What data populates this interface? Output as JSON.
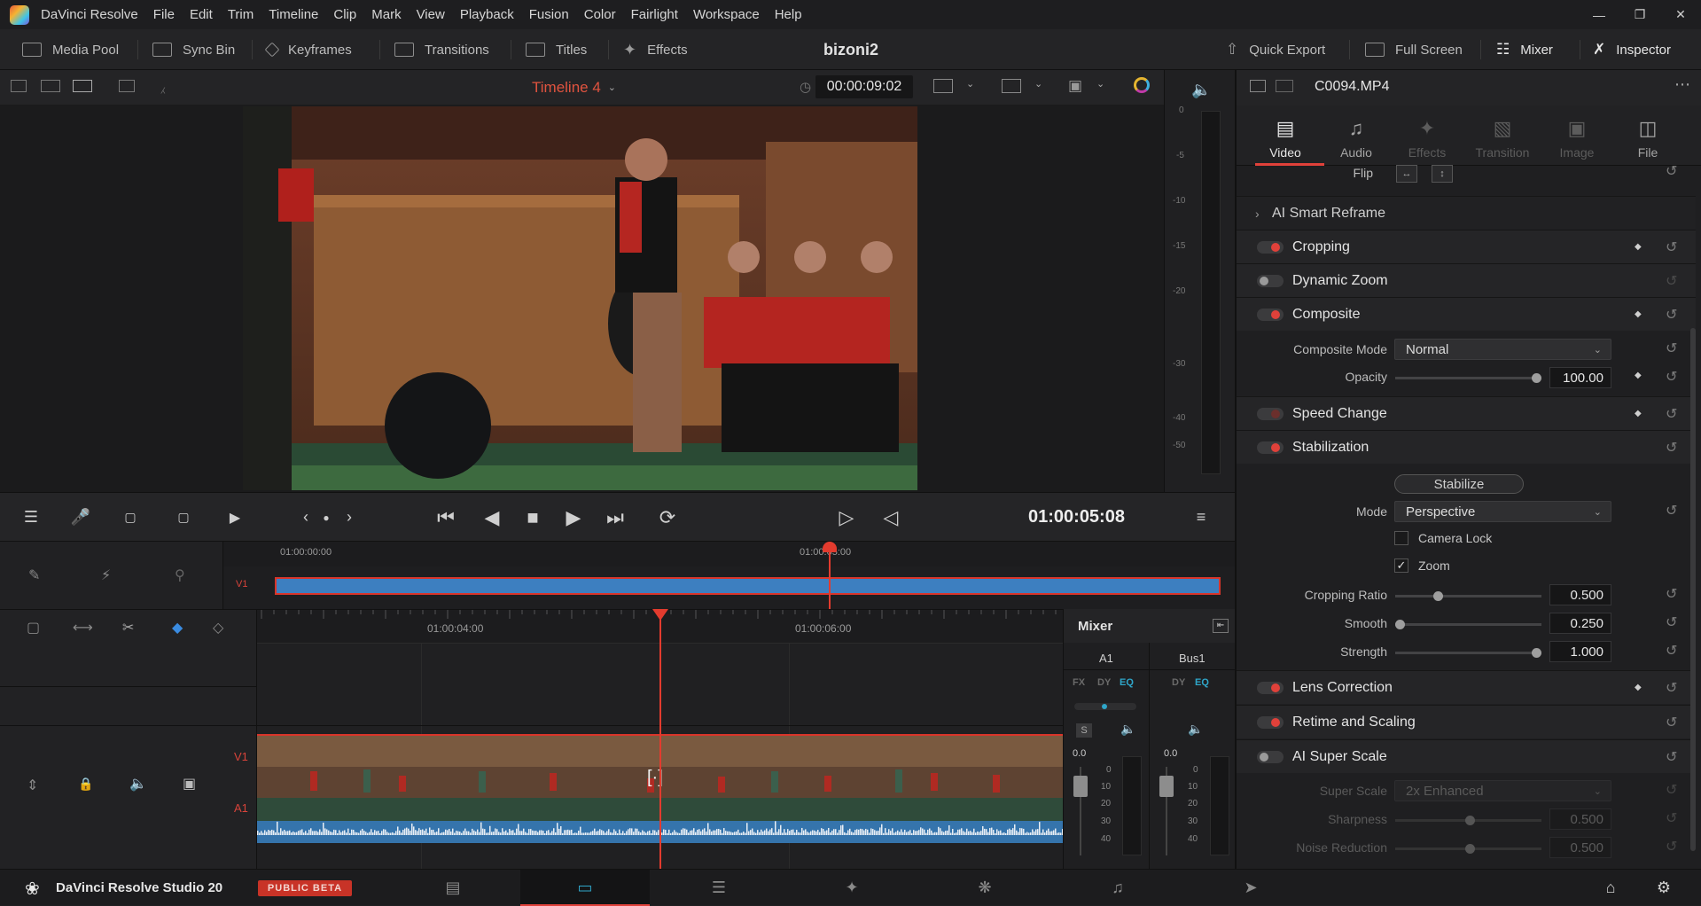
{
  "menubar": {
    "app_name": "DaVinci Resolve",
    "items": [
      "File",
      "Edit",
      "Trim",
      "Timeline",
      "Clip",
      "Mark",
      "View",
      "Playback",
      "Fusion",
      "Color",
      "Fairlight",
      "Workspace",
      "Help"
    ]
  },
  "toolbar": {
    "media_pool": "Media Pool",
    "sync_bin": "Sync Bin",
    "keyframes": "Keyframes",
    "transitions": "Transitions",
    "titles": "Titles",
    "effects": "Effects",
    "project_title": "bizoni2",
    "quick_export": "Quick Export",
    "full_screen": "Full Screen",
    "mixer": "Mixer",
    "inspector": "Inspector"
  },
  "viewer": {
    "timeline_name": "Timeline 4",
    "source_timecode": "00:00:09:02",
    "record_timecode": "01:00:05:08",
    "meter_scale": [
      "0",
      "-5",
      "-10",
      "-15",
      "-20",
      "-30",
      "-40",
      "-50"
    ]
  },
  "mini_timeline": {
    "track": "V1",
    "ticks": [
      "01:00:00:00",
      "01:00:05:00"
    ]
  },
  "edit_timeline": {
    "ticks": [
      "01:00:04:00",
      "01:00:06:00"
    ],
    "tracks": [
      "V1",
      "A1"
    ]
  },
  "mixer": {
    "title": "Mixer",
    "channels": [
      "A1",
      "Bus1"
    ],
    "fx": "FX",
    "dy": "DY",
    "eq": "EQ",
    "solo": "S",
    "level_a1": "0.0",
    "level_bus1": "0.0",
    "fader_scale": [
      "0",
      "10",
      "20",
      "30",
      "40"
    ]
  },
  "inspector": {
    "clip_name": "C0094.MP4",
    "tabs": [
      "Video",
      "Audio",
      "Effects",
      "Transition",
      "Image",
      "File"
    ],
    "flip_label": "Flip",
    "ai_smart_reframe": "AI Smart Reframe",
    "sections": {
      "cropping": "Cropping",
      "dynamic_zoom": "Dynamic Zoom",
      "composite": "Composite",
      "speed_change": "Speed Change",
      "stabilization": "Stabilization",
      "lens_correction": "Lens Correction",
      "retime_scaling": "Retime and Scaling",
      "ai_super_scale": "AI Super Scale"
    },
    "composite_mode_label": "Composite Mode",
    "composite_mode_value": "Normal",
    "opacity_label": "Opacity",
    "opacity_value": "100.00",
    "opacity_level": 1.0,
    "stabilize_button": "Stabilize",
    "mode_label": "Mode",
    "mode_value": "Perspective",
    "camera_lock_label": "Camera Lock",
    "camera_lock_checked": false,
    "zoom_label": "Zoom",
    "zoom_checked": true,
    "cropping_ratio_label": "Cropping Ratio",
    "cropping_ratio_value": "0.500",
    "cropping_ratio_level": 0.28,
    "smooth_label": "Smooth",
    "smooth_value": "0.250",
    "smooth_level": 0.0,
    "strength_label": "Strength",
    "strength_value": "1.000",
    "strength_level": 1.0,
    "super_scale_label": "Super Scale",
    "super_scale_value": "2x Enhanced",
    "sharpness_label": "Sharpness",
    "sharpness_value": "0.500",
    "noise_reduction_label": "Noise Reduction",
    "noise_reduction_value": "0.500"
  },
  "bottombar": {
    "product": "DaVinci Resolve Studio 20",
    "badge": "PUBLIC BETA"
  },
  "colors": {
    "accent_red": "#e0413a",
    "timeline_blue": "#3d7fc0",
    "eq_cyan": "#2fa6c9"
  }
}
